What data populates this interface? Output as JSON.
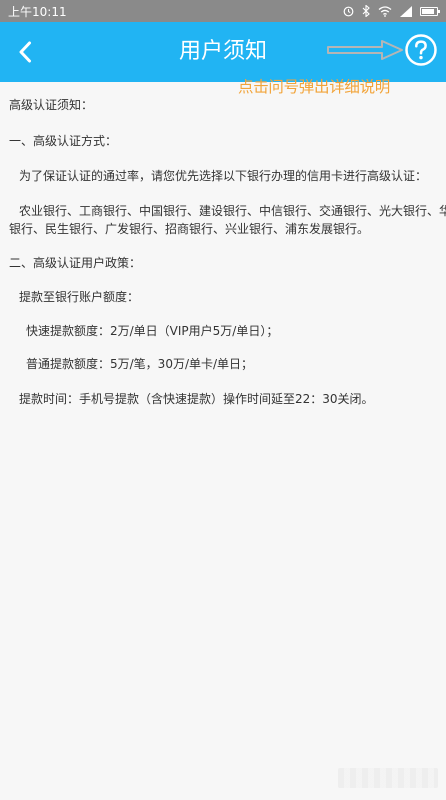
{
  "status_bar": {
    "time": "上午10:11"
  },
  "header": {
    "title": "用户须知",
    "back_icon": "chevron-left-icon",
    "help_icon": "question-circle-icon",
    "background": "#21b4f3"
  },
  "annotation": {
    "text": "点击问号弹出详细说明",
    "color": "#f2a43a"
  },
  "content": {
    "intro": "高级认证须知：",
    "section1_title": "一、高级认证方式：",
    "section1_desc": "为了保证认证的通过率，请您优先选择以下银行办理的信用卡进行高级认证：",
    "banks_line1": "农业银行、工商银行、中国银行、建设银行、中信银行、交通银行、光大银行、华夏",
    "banks_line2": "银行、民生银行、广发银行、招商银行、兴业银行、浦东发展银行。",
    "section2_title": "二、高级认证用户政策：",
    "withdraw_title": "提款至银行账户额度：",
    "fast_withdraw": "快速提款额度：2万/单日（VIP用户5万/单日）；",
    "normal_withdraw": "普通提款额度：5万/笔，30万/单卡/单日；",
    "withdraw_time": "提款时间：手机号提款（含快速提款）操作时间延至22：30关闭。"
  }
}
